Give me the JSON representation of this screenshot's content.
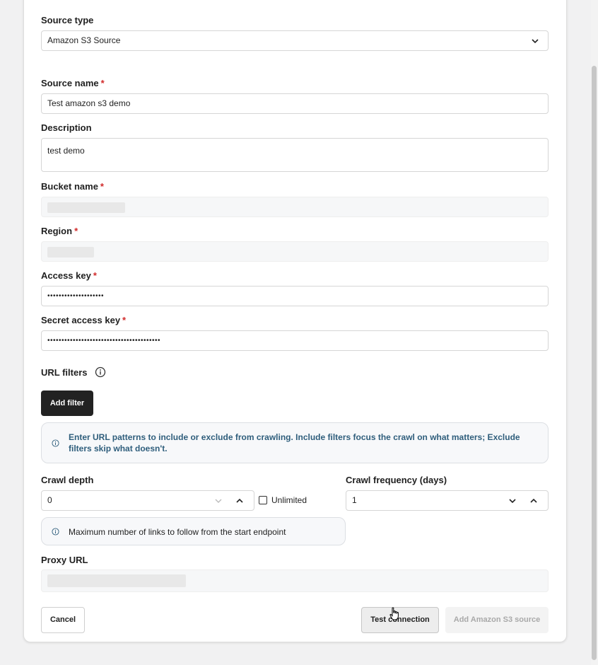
{
  "form": {
    "source_type": {
      "label": "Source type",
      "value": "Amazon S3 Source"
    },
    "source_name": {
      "label": "Source name",
      "required": "*",
      "value": "Test amazon s3 demo"
    },
    "description": {
      "label": "Description",
      "value": "test demo"
    },
    "bucket_name": {
      "label": "Bucket name",
      "required": "*"
    },
    "region": {
      "label": "Region",
      "required": "*"
    },
    "access_key": {
      "label": "Access key",
      "required": "*",
      "value": "••••••••••••••••••••"
    },
    "secret_access_key": {
      "label": "Secret access key",
      "required": "*",
      "value": "••••••••••••••••••••••••••••••••••••••••"
    },
    "url_filters": {
      "label": "URL filters",
      "add_filter_label": "Add filter",
      "info_text": "Enter URL patterns to include or exclude from crawling. Include filters focus the crawl on what matters; Exclude filters skip what doesn't."
    },
    "crawl_depth": {
      "label": "Crawl depth",
      "value": "0",
      "unlimited_label": "Unlimited",
      "info_text": "Maximum number of links to follow from the start endpoint"
    },
    "crawl_frequency": {
      "label": "Crawl frequency (days)",
      "value": "1"
    },
    "proxy_url": {
      "label": "Proxy URL"
    }
  },
  "footer": {
    "cancel_label": "Cancel",
    "test_connection_label": "Test connection",
    "add_source_label": "Add Amazon S3 source"
  },
  "colors": {
    "required": "#d12a2a",
    "info_text": "#2f5e7c",
    "dark_button": "#222222"
  }
}
